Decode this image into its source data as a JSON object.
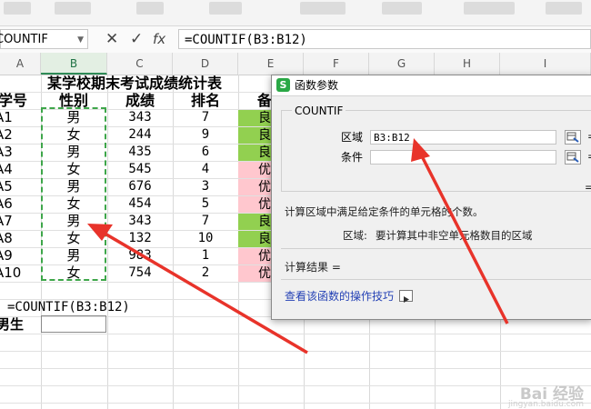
{
  "formula_bar": {
    "name_box": "COUNTIF",
    "cancel_glyph": "✕",
    "confirm_glyph": "✓",
    "fx_glyph": "fx",
    "formula": "=COUNTIF(B3:B12)"
  },
  "columns": [
    "A",
    "B",
    "C",
    "D",
    "E",
    "F",
    "G",
    "H",
    "I"
  ],
  "sheet": {
    "title": "某学校期末考试成绩统计表",
    "headers": [
      "学号",
      "性别",
      "成绩",
      "排名",
      "备"
    ],
    "rows": [
      {
        "id": "A1",
        "gender": "男",
        "score": "343",
        "rank": "7",
        "tag": "良",
        "tag_color": "#92d050"
      },
      {
        "id": "A2",
        "gender": "女",
        "score": "244",
        "rank": "9",
        "tag": "良",
        "tag_color": "#92d050"
      },
      {
        "id": "A3",
        "gender": "男",
        "score": "435",
        "rank": "6",
        "tag": "良",
        "tag_color": "#92d050"
      },
      {
        "id": "A4",
        "gender": "女",
        "score": "545",
        "rank": "4",
        "tag": "优",
        "tag_color": "#ffc7ce"
      },
      {
        "id": "A5",
        "gender": "男",
        "score": "676",
        "rank": "3",
        "tag": "优",
        "tag_color": "#ffc7ce"
      },
      {
        "id": "A6",
        "gender": "女",
        "score": "454",
        "rank": "5",
        "tag": "优",
        "tag_color": "#ffc7ce"
      },
      {
        "id": "A7",
        "gender": "男",
        "score": "343",
        "rank": "7",
        "tag": "良",
        "tag_color": "#92d050"
      },
      {
        "id": "A8",
        "gender": "女",
        "score": "132",
        "rank": "10",
        "tag": "良",
        "tag_color": "#92d050"
      },
      {
        "id": "A9",
        "gender": "男",
        "score": "983",
        "rank": "1",
        "tag": "优",
        "tag_color": "#ffc7ce"
      },
      {
        "id": "A10",
        "gender": "女",
        "score": "754",
        "rank": "2",
        "tag": "优",
        "tag_color": "#ffc7ce"
      }
    ],
    "formula_cell": "=COUNTIF(B3:B12)",
    "label_cell": "男生"
  },
  "dialog": {
    "title": "函数参数",
    "logo_glyph": "S",
    "function_name": "COUNTIF",
    "arg1_label": "区域",
    "arg1_value": "B3:B12",
    "arg2_label": "条件",
    "arg2_value": "",
    "equals": "=",
    "description": "计算区域中满足给定条件的单元格的个数。",
    "arg_help_label": "区域:",
    "arg_help_text": "要计算其中非空单元格数目的区域",
    "result_label": "计算结果 =",
    "link_text": "查看该函数的操作技巧"
  },
  "watermark": {
    "brand": "Bai 经验",
    "domain": "jingyan.baidu.com"
  },
  "colors": {
    "selection_border": "#3ea64a",
    "arrow": "#e8332a",
    "link": "#2441b5"
  }
}
